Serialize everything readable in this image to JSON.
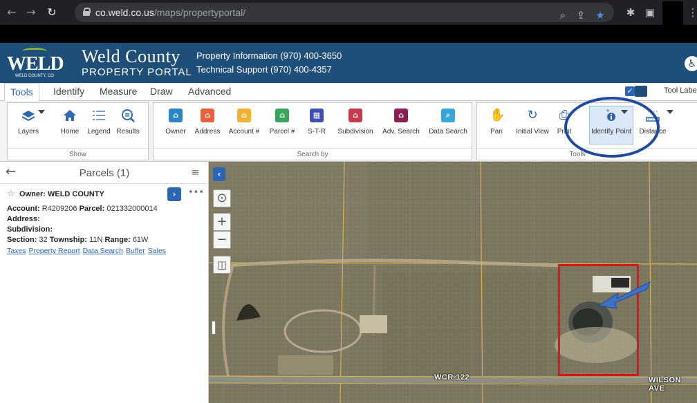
{
  "browser": {
    "url_host": "co.weld.co.us",
    "url_path": "/maps/propertyportal/"
  },
  "header": {
    "logo_text": "WELD",
    "logo_sub": "WELD COUNTY, CO",
    "county": "Weld County",
    "portal": "PROPERTY PORTAL",
    "contact_property": "Property Information (970) 400-3650",
    "contact_support": "Technical Support (970) 400-4357"
  },
  "tabs": [
    "Tools",
    "Identify",
    "Measure",
    "Draw",
    "Advanced"
  ],
  "tool_labels": "Tool Labels",
  "ribbon": {
    "show": {
      "label": "Show",
      "tools": [
        "Layers",
        "Home",
        "Legend",
        "Results"
      ]
    },
    "search_by": {
      "label": "Search by",
      "tools": [
        "Owner",
        "Address",
        "Account #",
        "Parcel #",
        "S-T-R",
        "Subdivision",
        "Adv. Search",
        "Data Search"
      ]
    },
    "tools": {
      "label": "Tools",
      "tools": [
        "Pan",
        "Initial View",
        "Print",
        "Identify Point",
        "Distance"
      ]
    }
  },
  "panel": {
    "title": "Parcels (1)",
    "owner_label": "Owner:",
    "owner_value": "WELD COUNTY",
    "account_label": "Account:",
    "account_value": "R4209206",
    "parcel_label": "Parcel:",
    "parcel_value": "021332000014",
    "address_label": "Address:",
    "subdivision_label": "Subdivision:",
    "section_label": "Section:",
    "section_value": "32",
    "township_label": "Township:",
    "township_value": "11N",
    "range_label": "Range:",
    "range_value": "61W",
    "links": [
      "Taxes",
      "Property Report",
      "Data Search",
      "Buffer",
      "Sales"
    ]
  },
  "map": {
    "road_1": "WCR 122",
    "road_2": "WILSON AVE"
  },
  "colors": {
    "header_bg": "#1f4e79",
    "accent": "#2b66b3",
    "parcel_outline": "#d8161c",
    "annotation": "#1e4aa0"
  }
}
